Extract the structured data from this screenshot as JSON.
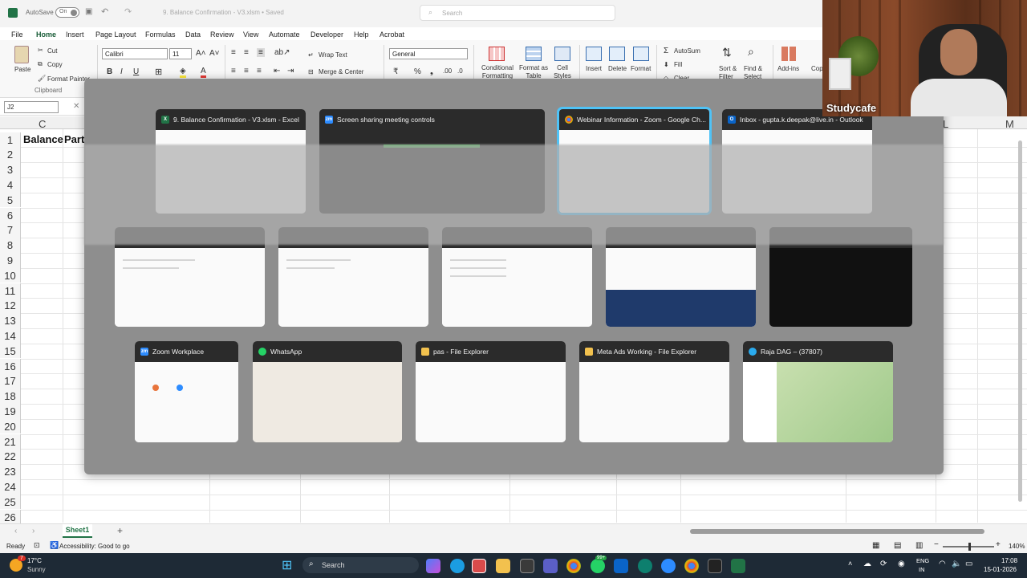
{
  "titlebar": {
    "autosave_label": "AutoSave",
    "autosave_state": "On",
    "doc_title": "9. Balance Confirmation - V3.xlsm • Saved",
    "search_placeholder": "Search"
  },
  "ribbon_tabs": [
    "File",
    "Home",
    "Insert",
    "Page Layout",
    "Formulas",
    "Data",
    "Review",
    "View",
    "Automate",
    "Developer",
    "Help",
    "Acrobat"
  ],
  "ribbon": {
    "paste": "Paste",
    "cut": "Cut",
    "copy": "Copy",
    "format_painter": "Format Painter",
    "clipboard_group": "Clipboard",
    "font_name": "Calibri",
    "font_size": "11",
    "wrap_text": "Wrap Text",
    "merge_center": "Merge & Center",
    "number_format": "General",
    "conditional_formatting": "Conditional Formatting",
    "format_as_table": "Format as Table",
    "cell_styles": "Cell Styles",
    "insert": "Insert",
    "delete": "Delete",
    "format": "Format",
    "autosum": "AutoSum",
    "fill": "Fill",
    "clear": "Clear",
    "sort_filter": "Sort & Filter",
    "find_select": "Find & Select",
    "addins": "Add-ins",
    "copilot": "Cop"
  },
  "formula_bar": {
    "name_box": "J2"
  },
  "grid": {
    "col_c": "C",
    "col_l": "L",
    "col_m": "M",
    "cell_c1": "Balance",
    "cell_d1": "Party",
    "rows": [
      "1",
      "2",
      "3",
      "4",
      "5",
      "6",
      "7",
      "8",
      "9",
      "10",
      "11",
      "12",
      "13",
      "14",
      "15",
      "16",
      "17",
      "18",
      "19",
      "20",
      "21",
      "22",
      "23",
      "24",
      "25",
      "26"
    ]
  },
  "task_switcher": {
    "row1": [
      {
        "title": "9. Balance Confirmation - V3.xlsm - Excel",
        "icon": "excel-icon"
      },
      {
        "title": "Screen sharing meeting controls",
        "icon": "zoom-icon"
      },
      {
        "title": "Webinar Information - Zoom - Google Ch...",
        "icon": "chrome-icon"
      },
      {
        "title": "Inbox - gupta.k.deepak@live.in - Outlook",
        "icon": "outlook-icon"
      }
    ],
    "row3": [
      {
        "title": "Zoom Workplace",
        "icon": "zoom-icon"
      },
      {
        "title": "WhatsApp",
        "icon": "whatsapp-icon"
      },
      {
        "title": "pas - File Explorer",
        "icon": "folder-icon"
      },
      {
        "title": "Meta Ads Working - File Explorer",
        "icon": "folder-icon"
      },
      {
        "title": "Raja DAG – (37807)",
        "icon": "telegram-icon"
      }
    ]
  },
  "sheet": {
    "tab": "Sheet1",
    "add": "+"
  },
  "status": {
    "ready": "Ready",
    "accessibility": "Accessibility: Good to go",
    "zoom": "140%"
  },
  "taskbar": {
    "weather_temp": "17°C",
    "weather_desc": "Sunny",
    "weather_badge": "7",
    "search": "Search",
    "lang1": "ENG",
    "lang2": "IN",
    "time": "17:08",
    "date": "15-01-2026",
    "badge_count": "99+"
  },
  "webcam": {
    "brand": "Studycafe"
  },
  "colors": {
    "excel_green": "#217346",
    "selected_border": "#4fc3f7",
    "taskbar": "#1e2a36"
  }
}
